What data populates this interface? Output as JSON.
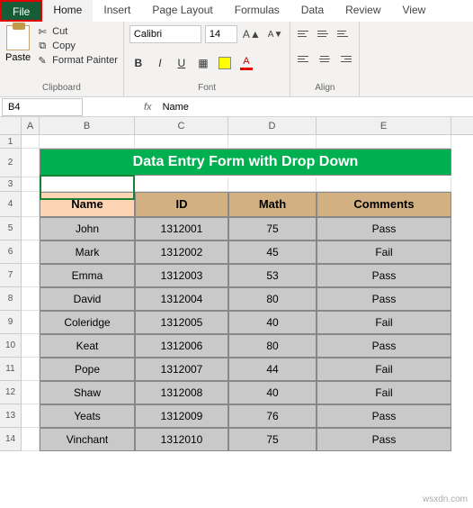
{
  "tabs": {
    "file": "File",
    "home": "Home",
    "insert": "Insert",
    "pagelayout": "Page Layout",
    "formulas": "Formulas",
    "data": "Data",
    "review": "Review",
    "view": "View"
  },
  "ribbon": {
    "paste": "Paste",
    "cut": "Cut",
    "copy": "Copy",
    "fmtpainter": "Format Painter",
    "clipboard_label": "Clipboard",
    "font_name": "Calibri",
    "font_size": "14",
    "font_label": "Font",
    "align_label": "Alignment"
  },
  "namebox": "B4",
  "formula": "Name",
  "cols": {
    "A": "A",
    "B": "B",
    "C": "C",
    "D": "D",
    "E": "E"
  },
  "banner": "Data Entry Form with Drop Down",
  "headers": {
    "name": "Name",
    "id": "ID",
    "math": "Math",
    "comments": "Comments"
  },
  "rows": [
    {
      "n": "5",
      "name": "John",
      "id": "1312001",
      "math": "75",
      "c": "Pass"
    },
    {
      "n": "6",
      "name": "Mark",
      "id": "1312002",
      "math": "45",
      "c": "Fail"
    },
    {
      "n": "7",
      "name": "Emma",
      "id": "1312003",
      "math": "53",
      "c": "Pass"
    },
    {
      "n": "8",
      "name": "David",
      "id": "1312004",
      "math": "80",
      "c": "Pass"
    },
    {
      "n": "9",
      "name": "Coleridge",
      "id": "1312005",
      "math": "40",
      "c": "Fail"
    },
    {
      "n": "10",
      "name": "Keat",
      "id": "1312006",
      "math": "80",
      "c": "Pass"
    },
    {
      "n": "11",
      "name": "Pope",
      "id": "1312007",
      "math": "44",
      "c": "Fail"
    },
    {
      "n": "12",
      "name": "Shaw",
      "id": "1312008",
      "math": "40",
      "c": "Fail"
    },
    {
      "n": "13",
      "name": "Yeats",
      "id": "1312009",
      "math": "76",
      "c": "Pass"
    },
    {
      "n": "14",
      "name": "Vinchant",
      "id": "1312010",
      "math": "75",
      "c": "Pass"
    }
  ],
  "watermark": "wsxdn.com"
}
